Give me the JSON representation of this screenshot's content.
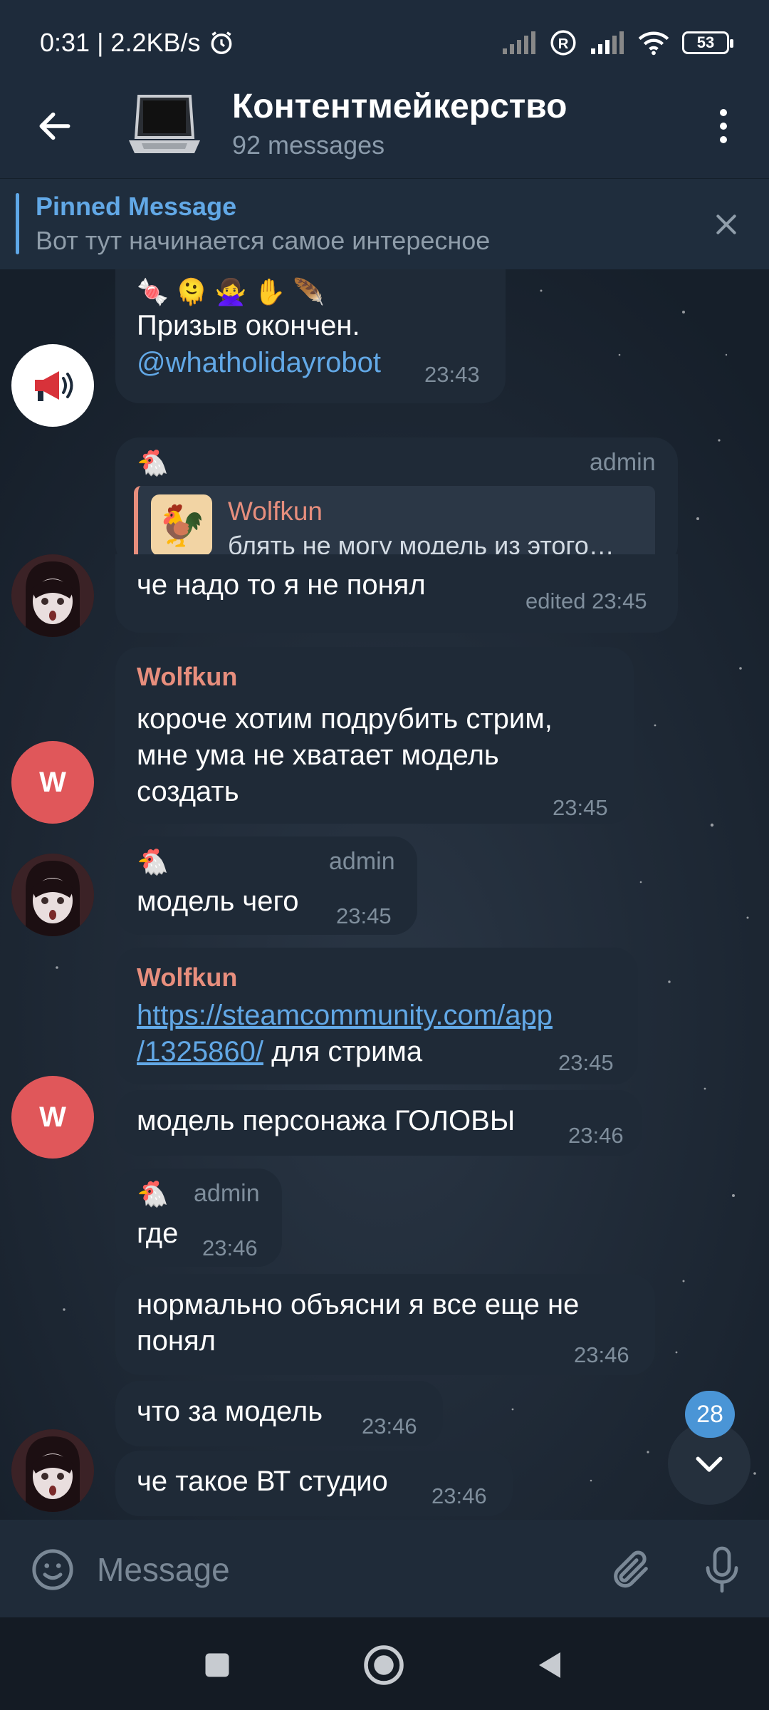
{
  "status_bar": {
    "time_speed": "0:31 | 2.2KB/s",
    "battery": "53"
  },
  "header": {
    "title": "Контентмейкерство",
    "subtitle": "92 messages"
  },
  "pinned": {
    "title": "Pinned Message",
    "text": "Вот тут начинается самое интересное"
  },
  "messages": [
    {
      "emojis": "🍬 🫠 🙅‍♀️ ✋ 🪶",
      "text": "Призыв окончен.",
      "link": "@whatholidayrobot",
      "time": "23:43"
    },
    {
      "tag": "admin",
      "reply_name": "Wolfkun",
      "reply_text": "блять не могу модель из этого…",
      "text": "че надо  то я не понял",
      "time": "edited 23:45"
    },
    {
      "sender": "Wolfkun",
      "lines": [
        "короче хотим подрубить стрим,",
        "мне ума не хватает модель",
        "создать"
      ],
      "time": "23:45"
    },
    {
      "tag": "admin",
      "text": "модель чего",
      "time": "23:45"
    },
    {
      "sender": "Wolfkun",
      "link_line1": "https://steamcommunity.com/app",
      "link_line2": "/1325860/",
      "text_after_link": " для стрима",
      "time": "23:45"
    },
    {
      "text": "модель персонажа ГОЛОВЫ",
      "time": "23:46"
    },
    {
      "tag": "admin",
      "text": "где",
      "time": "23:46"
    },
    {
      "lines": [
        "нормально объясни я все еще не",
        "понял"
      ],
      "time": "23:46"
    },
    {
      "text": "что за модель",
      "time": "23:46"
    },
    {
      "text": "че такое ВТ студио",
      "time": "23:46"
    }
  ],
  "avatars": {
    "wolfkun_initial": "W"
  },
  "unread_count": "28",
  "composer": {
    "placeholder": "Message"
  },
  "icons": {
    "back": "arrow-left-icon",
    "menu": "more-vertical-icon",
    "close": "close-icon",
    "emoji": "smile-icon",
    "attach": "paperclip-icon",
    "mic": "microphone-icon",
    "scroll_down": "chevron-down-icon"
  },
  "colors": {
    "accent": "#62a8e6",
    "sender_name": "#e78e7d",
    "bubble": "#1f2a37",
    "avatar_w": "#e0575a"
  }
}
